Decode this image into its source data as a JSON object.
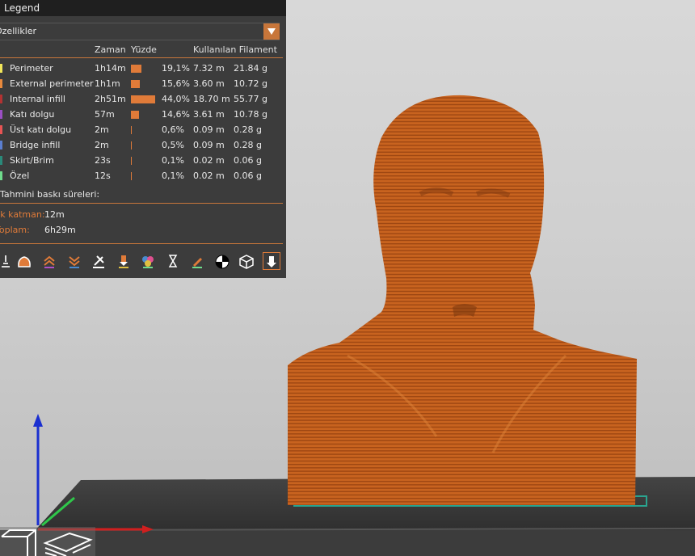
{
  "legend": {
    "title": "Legend",
    "view_select": "Özellikler",
    "columns": {
      "time": "Zaman",
      "percent": "Yüzde",
      "used": "Kullanılan Filament"
    },
    "rows": [
      {
        "name": "Perimeter",
        "color": "#f2e65a",
        "time": "1h14m",
        "share": 0.191,
        "percent": "19,1%",
        "length": "7.32 m",
        "weight": "21.84 g"
      },
      {
        "name": "External perimeter",
        "color": "#e8893d",
        "time": "1h1m",
        "share": 0.156,
        "percent": "15,6%",
        "length": "3.60 m",
        "weight": "10.72 g"
      },
      {
        "name": "Internal infill",
        "color": "#b33232",
        "time": "2h51m",
        "share": 0.44,
        "percent": "44,0%",
        "length": "18.70 m",
        "weight": "55.77 g"
      },
      {
        "name": "Katı dolgu",
        "color": "#9b4fc4",
        "time": "57m",
        "share": 0.146,
        "percent": "14,6%",
        "length": "3.61 m",
        "weight": "10.78 g"
      },
      {
        "name": "Üst katı dolgu",
        "color": "#e85454",
        "time": "2m",
        "share": 0.006,
        "percent": "0,6%",
        "length": "0.09 m",
        "weight": "0.28 g"
      },
      {
        "name": "Bridge infill",
        "color": "#5b7fd0",
        "time": "2m",
        "share": 0.005,
        "percent": "0,5%",
        "length": "0.09 m",
        "weight": "0.28 g"
      },
      {
        "name": "Skirt/Brim",
        "color": "#2a8a7a",
        "time": "23s",
        "share": 0.001,
        "percent": "0,1%",
        "length": "0.02 m",
        "weight": "0.06 g"
      },
      {
        "name": "Özel",
        "color": "#6fdc8c",
        "time": "12s",
        "share": 0.001,
        "percent": "0,1%",
        "length": "0.02 m",
        "weight": "0.06 g"
      }
    ],
    "estimate_title": "Tahmini baskı süreleri:",
    "first_layer_label": "İlk katman:",
    "first_layer_value": "12m",
    "total_label": "Toplam:",
    "total_value": "6h29m",
    "toolbar_icons": [
      "travel-icon",
      "wipe-icon",
      "retractions-icon",
      "deretractions-icon",
      "seams-icon",
      "tool-changes-icon",
      "color-changes-icon",
      "pause-icon",
      "custom-gcode-icon",
      "center-of-gravity-icon",
      "shells-icon",
      "tool-marker-icon"
    ]
  },
  "colors": {
    "accent": "#e07b39",
    "model": "#c8631f",
    "bed": "#3a3a3a"
  }
}
